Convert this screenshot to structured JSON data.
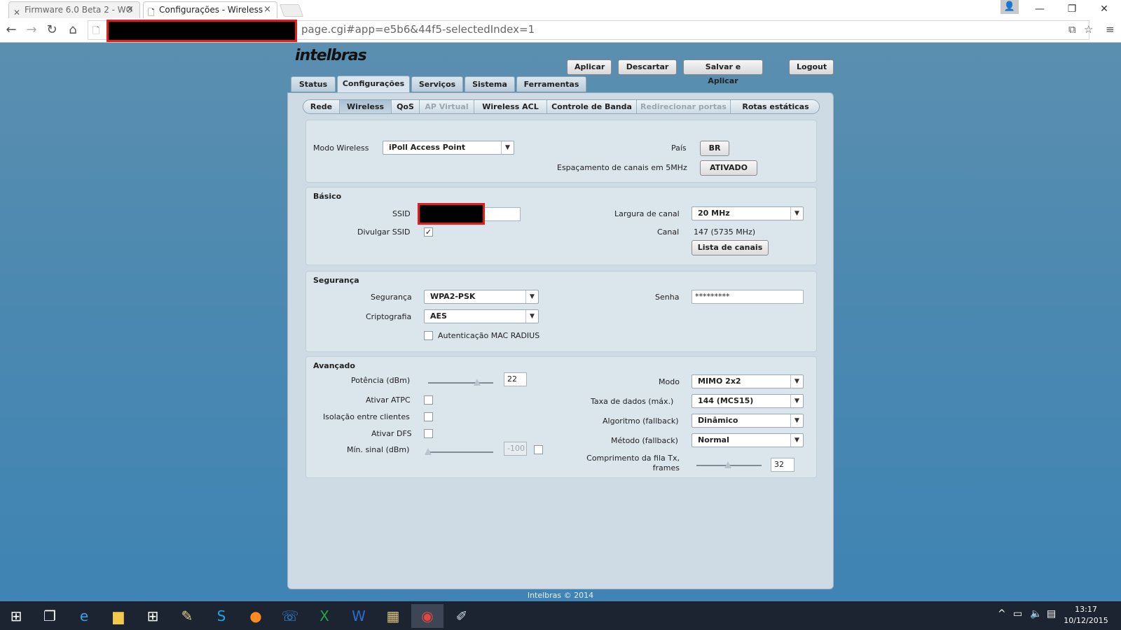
{
  "browser": {
    "tabs": [
      {
        "title": "Firmware 6.0 Beta 2 - WO",
        "icon": "tools-icon"
      },
      {
        "title": "Configurações - Wireless",
        "icon": "page-icon"
      }
    ],
    "url": "page.cgi#app=e5b6&44f5-selectedIndex=1"
  },
  "header": {
    "logo": "intelbras",
    "buttons": {
      "apply": "Aplicar",
      "discard": "Descartar",
      "save_apply": "Salvar e Aplicar",
      "logout": "Logout"
    }
  },
  "main_tabs": [
    "Status",
    "Configurações",
    "Serviços",
    "Sistema",
    "Ferramentas"
  ],
  "sub_tabs": [
    "Rede",
    "Wireless",
    "QoS",
    "AP Virtual",
    "Wireless ACL",
    "Controle de Banda",
    "Redirecionar portas",
    "Rotas estáticas"
  ],
  "general": {
    "mode_label": "Modo Wireless",
    "mode_value": "iPoll Access Point",
    "country_label": "País",
    "country_value": "BR",
    "spacing_label": "Espaçamento de canais em 5MHz",
    "spacing_value": "ATIVADO"
  },
  "basic": {
    "title": "Básico",
    "ssid_label": "SSID",
    "broadcast_label": "Divulgar SSID",
    "broadcast_checked": "✓",
    "width_label": "Largura de canal",
    "width_value": "20 MHz",
    "channel_label": "Canal",
    "channel_value": "147 (5735 MHz)",
    "channel_list_button": "Lista de canais"
  },
  "security": {
    "title": "Segurança",
    "security_label": "Segurança",
    "security_value": "WPA2-PSK",
    "crypto_label": "Criptografia",
    "crypto_value": "AES",
    "radius_label": "Autenticação MAC RADIUS",
    "password_label": "Senha",
    "password_value": "*********"
  },
  "advanced": {
    "title": "Avançado",
    "power_label": "Potência (dBm)",
    "power_value": "22",
    "power_level": 0.75,
    "atpc_label": "Ativar ATPC",
    "isolation_label": "Isolação entre clientes",
    "dfs_label": "Ativar DFS",
    "min_signal_label": "Mín. sinal (dBm)",
    "min_signal_value": "-100",
    "min_signal_level": 0,
    "mode_label": "Modo",
    "mode_value": "MIMO 2x2",
    "rate_label": "Taxa de dados (máx.)",
    "rate_value": "144 (MCS15)",
    "algo_label": "Algoritmo (fallback)",
    "algo_value": "Dinâmico",
    "method_label": "Método (fallback)",
    "method_value": "Normal",
    "queue_label_1": "Comprimento da fila Tx,",
    "queue_label_2": "frames",
    "queue_value": "32",
    "queue_level": 0.48
  },
  "footer": "Intelbras © 2014",
  "taskbar": {
    "time": "13:17",
    "date": "10/12/2015"
  }
}
